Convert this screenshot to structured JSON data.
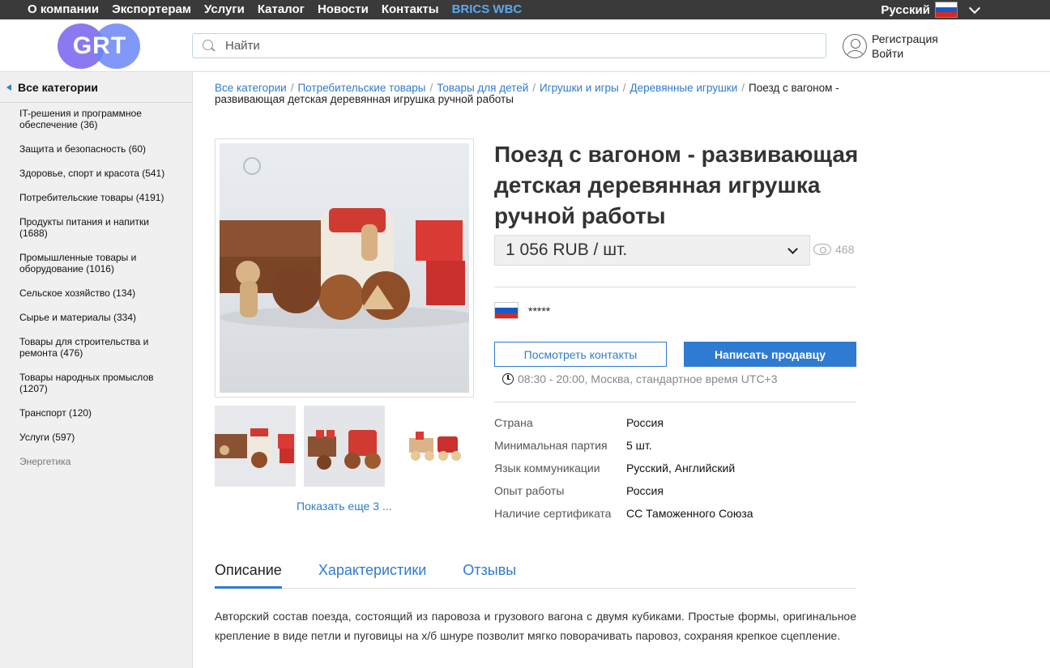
{
  "topnav": {
    "items": [
      "О компании",
      "Экспортерам",
      "Услуги",
      "Каталог",
      "Новости",
      "Контакты"
    ],
    "accent_item": "BRICS WBC",
    "language": "Русский"
  },
  "header": {
    "logo_text": "GRT",
    "search_placeholder": "Найти",
    "register": "Регистрация",
    "login": "Войти"
  },
  "sidebar": {
    "title": "Все категории",
    "items": [
      "IT-решения и программное обеспечение (36)",
      "Защита и безопасность (60)",
      "Здоровье, спорт и красота (541)",
      "Потребительские товары (4191)",
      "Продукты питания и напитки (1688)",
      "Промышленные товары и оборудование (1016)",
      "Сельское хозяйство (134)",
      "Сырье и материалы (334)",
      "Товары для строительства и ремонта (476)",
      "Товары народных промыслов (1207)",
      "Транспорт (120)",
      "Услуги (597)",
      "Энергетика"
    ]
  },
  "breadcrumbs": {
    "links": [
      "Все категории",
      "Потребительские товары",
      "Товары для детей",
      "Игрушки и игры",
      "Деревянные игрушки"
    ],
    "current": "Поезд с вагоном - развивающая детская деревянная игрушка ручной работы"
  },
  "product": {
    "title": "Поезд с вагоном - развивающая детская деревянная игрушка ручной работы",
    "price": "1 056 RUB / шт.",
    "views": "468",
    "seller_name": "*****",
    "show_more": "Показать еще 3 ...",
    "btn_contacts": "Посмотреть контакты",
    "btn_write": "Написать продавцу",
    "hours": "08:30 - 20:00, Москва, стандартное время UTC+3",
    "specs": [
      {
        "k": "Страна",
        "v": "Россия"
      },
      {
        "k": "Минимальная партия",
        "v": "5 шт."
      },
      {
        "k": "Язык коммуникации",
        "v": "Русский, Английский"
      },
      {
        "k": "Опыт работы",
        "v": "Россия"
      },
      {
        "k": "Наличие сертификата",
        "v": "СС Таможенного Союза"
      }
    ]
  },
  "tabs": [
    "Описание",
    "Характеристики",
    "Отзывы"
  ],
  "description": "Авторский состав поезда, состоящий из паровоза и грузового вагона с двумя кубиками. Простые формы, оригинальное крепление в виде петли и пуговицы на х/б шнуре позволит мягко поворачивать паровоз, сохраняя крепкое сцепление.",
  "colors": {
    "accent": "#2f7bd1",
    "topbar": "#3a3a3a",
    "sidebar_bg": "#f0f0f0"
  }
}
